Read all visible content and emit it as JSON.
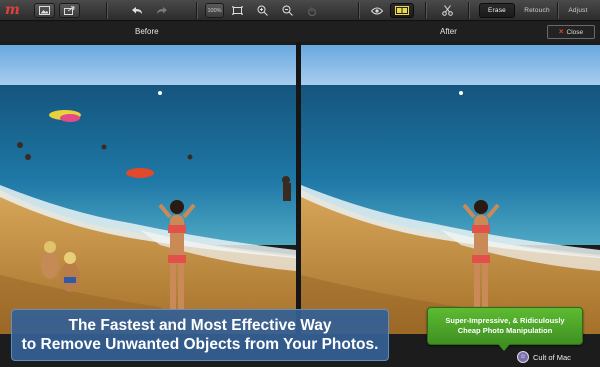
{
  "app": {
    "logo_text": "m"
  },
  "toolbar": {
    "zoom_percent": "100%",
    "icons": [
      "image-icon",
      "export-icon",
      "undo-icon",
      "redo-icon",
      "fit-icon",
      "zoom-in-icon",
      "zoom-out-icon",
      "hand-icon",
      "eye-icon",
      "split-view-icon",
      "scissors-icon"
    ],
    "mode_tabs": [
      {
        "label": "Erase",
        "active": true
      },
      {
        "label": "Retouch",
        "active": false
      },
      {
        "label": "Adjust",
        "active": false
      }
    ]
  },
  "compare": {
    "before_label": "Before",
    "after_label": "After",
    "close_label": "Close"
  },
  "promo": {
    "headline_line1": "The Fastest and Most Effective Way",
    "headline_line2": "to Remove Unwanted Objects from Your Photos.",
    "badge_line1": "Super-Impressive, & Ridiculously",
    "badge_line2": "Cheap Photo Manipulation",
    "credit": "Cult of Mac"
  },
  "colors": {
    "accent_red": "#e2413b",
    "headline_blue": "#346094",
    "badge_green": "#4fa82a",
    "sky": "#7fb6e6",
    "sea": "#1f79a4",
    "sand": "#c7913f"
  }
}
